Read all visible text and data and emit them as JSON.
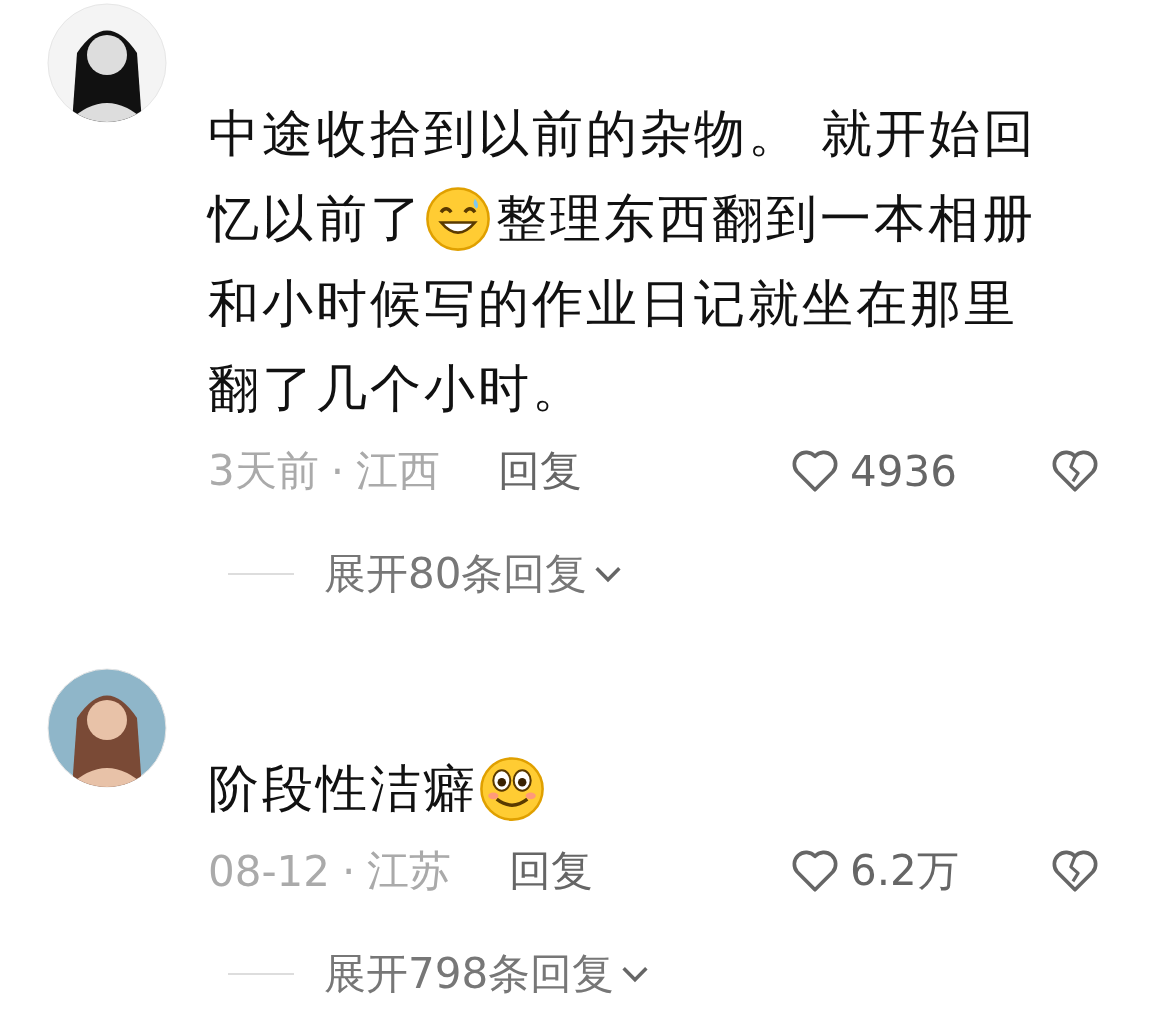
{
  "comments": [
    {
      "lines": [
        [
          {
            "kind": "text",
            "text": "中途收拾到以前的杂物。 就开始回"
          }
        ],
        [
          {
            "kind": "text",
            "text": "忆以前了"
          },
          {
            "kind": "grin"
          },
          {
            "kind": "text",
            "text": "整理东西翻到一本相册"
          }
        ],
        [
          {
            "kind": "text",
            "text": "和小时候写的作业日记就坐在那里"
          }
        ],
        [
          {
            "kind": "text",
            "text": "翻了几个小时。"
          }
        ]
      ],
      "time": "3天前",
      "separator": "·",
      "location": "江西",
      "reply": "回复",
      "likes": "4936",
      "expand": "展开80条回复"
    },
    {
      "lines": [
        [
          {
            "kind": "text",
            "text": "阶段性洁癖"
          },
          {
            "kind": "smile"
          }
        ]
      ],
      "time": "08-12",
      "separator": "·",
      "location": "江苏",
      "reply": "回复",
      "likes": "6.2万",
      "expand": "展开798条回复"
    }
  ]
}
